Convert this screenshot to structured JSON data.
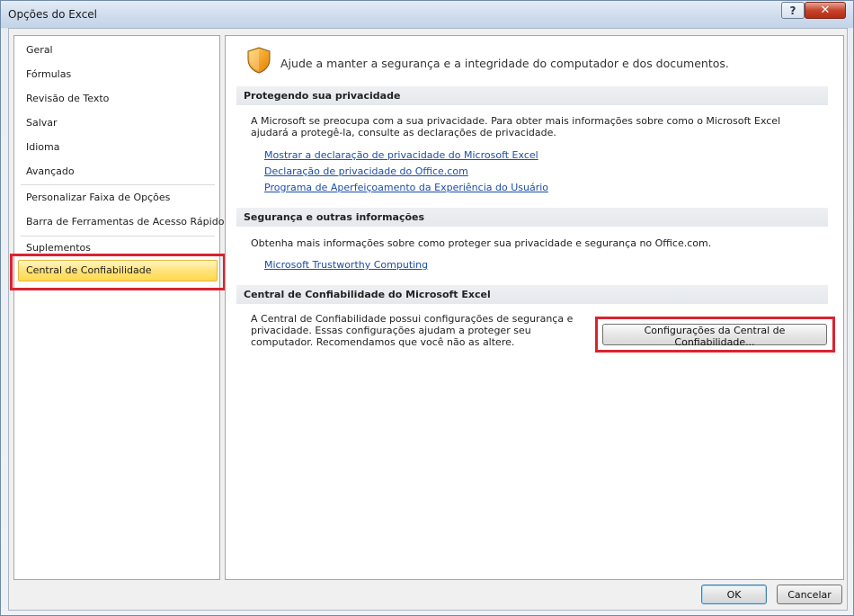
{
  "window": {
    "title": "Opções do Excel",
    "help_label": "?",
    "close_label": "✕"
  },
  "nav": {
    "items": [
      {
        "label": "Geral"
      },
      {
        "label": "Fórmulas"
      },
      {
        "label": "Revisão de Texto"
      },
      {
        "label": "Salvar"
      },
      {
        "label": "Idioma"
      },
      {
        "label": "Avançado"
      },
      {
        "label": "Personalizar Faixa de Opções"
      },
      {
        "label": "Barra de Ferramentas de Acesso Rápido"
      },
      {
        "label": "Suplementos"
      },
      {
        "label": "Central de Confiabilidade"
      }
    ],
    "selected": "Central de Confiabilidade"
  },
  "main": {
    "icon": "shield-icon",
    "intro": "Ajude a manter a segurança e a integridade do computador e dos documentos.",
    "privacy": {
      "header": "Protegendo sua privacidade",
      "text": "A Microsoft se preocupa com a sua privacidade. Para obter mais informações sobre como o Microsoft Excel ajudará a protegê-la, consulte as declarações de privacidade.",
      "links": [
        "Mostrar a declaração de privacidade do Microsoft Excel",
        "Declaração de privacidade do Office.com",
        "Programa de Aperfeiçoamento da Experiência do Usuário"
      ]
    },
    "security": {
      "header": "Segurança e outras informações",
      "text": "Obtenha mais informações sobre como proteger sua privacidade e segurança no Office.com.",
      "link": "Microsoft Trustworthy Computing"
    },
    "trust_center": {
      "header": "Central de Confiabilidade do Microsoft Excel",
      "text": "A Central de Confiabilidade possui configurações de segurança e privacidade. Essas configurações ajudam a proteger seu computador. Recomendamos que você não as altere.",
      "button_label": "Configurações da Central de Confiabilidade..."
    }
  },
  "footer": {
    "ok_label": "OK",
    "cancel_label": "Cancelar"
  },
  "colors": {
    "highlight_box": "#d9242e",
    "selected_nav": "#ffe37a",
    "link": "#1b4ea5"
  }
}
